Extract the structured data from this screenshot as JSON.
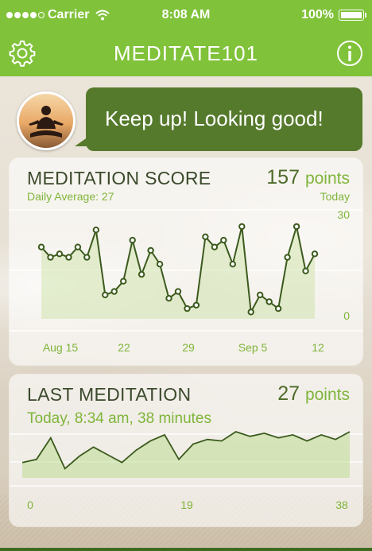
{
  "status_bar": {
    "carrier": "Carrier",
    "time": "8:08 AM",
    "battery": "100%"
  },
  "nav": {
    "title": "MEDITATE101",
    "settings_icon": "gear-icon",
    "info_icon": "info-icon"
  },
  "greeting": {
    "message": "Keep up! Looking good!"
  },
  "score_card": {
    "title": "MEDITATION SCORE",
    "value": "157",
    "unit": "points",
    "daily_average": "Daily Average: 27",
    "period": "Today"
  },
  "last_card": {
    "title": "LAST MEDITATION",
    "value": "27",
    "unit": "points",
    "details": "Today, 8:34 am, 38 minutes"
  },
  "chart_data": [
    {
      "type": "line",
      "x_tick_labels": [
        "Aug 15",
        "22",
        "29",
        "Sep 5",
        "12"
      ],
      "y_tick_labels": [
        "30",
        "0"
      ],
      "ylim": [
        0,
        30
      ],
      "values": [
        21,
        18,
        19,
        18,
        21,
        18,
        26,
        7,
        8,
        11,
        23,
        13,
        20,
        16,
        6,
        8,
        3,
        4,
        24,
        21,
        23,
        16,
        27,
        2,
        7,
        5,
        3,
        18,
        27,
        14,
        19
      ],
      "grid": true
    },
    {
      "type": "area",
      "x_tick_labels": [
        "0",
        "19",
        "38"
      ],
      "xlim": [
        0,
        38
      ],
      "values": [
        10,
        12,
        26,
        6,
        14,
        20,
        15,
        10,
        18,
        24,
        28,
        12,
        22,
        25,
        24,
        30,
        27,
        29,
        26,
        28,
        24,
        28,
        25,
        30
      ]
    }
  ],
  "colors": {
    "bar_green": "#80c23a",
    "bubble_green": "#557a2c",
    "line_dark": "#3b5a1d",
    "accent_text": "#7fb53a"
  }
}
